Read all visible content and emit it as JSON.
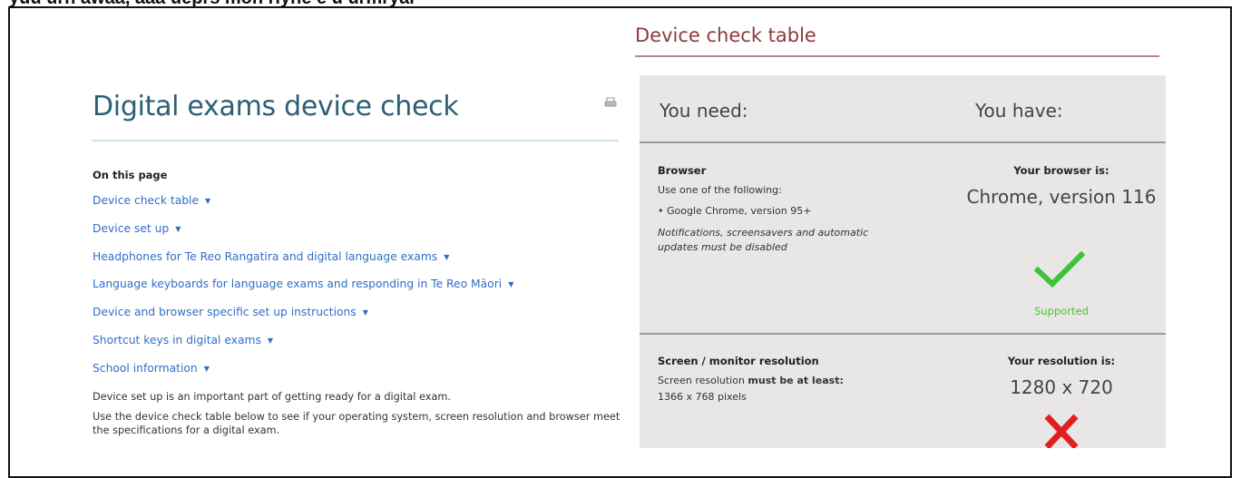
{
  "page": {
    "top_text": "yuu urn awaa, aaa ueprs mon riyne e u urmryar",
    "title": "Digital exams device check",
    "on_this_page_label": "On this page",
    "toc": [
      "Device check table",
      "Device set up",
      "Headphones for Te Reo Rangatira and digital language exams",
      "Language keyboards for language exams and responding in Te Reo Māori",
      "Device and browser specific set up instructions",
      "Shortcut keys in digital exams",
      "School information"
    ],
    "caret": "▼",
    "intro": [
      "Device set up is an important part of getting ready for a digital exam.",
      "Use the device check table below to see if your operating system, screen resolution and browser meet the specifications for a digital exam."
    ]
  },
  "device_check": {
    "heading": "Device check table",
    "you_need": "You need:",
    "you_have": "You have:",
    "browser": {
      "title": "Browser",
      "line1": "Use one of the following:",
      "bullet": "•  Google Chrome, version 95+",
      "note": "Notifications, screensavers and automatic updates must be disabled",
      "have_label": "Your browser is:",
      "have_value": "Chrome, version 116",
      "status": "Supported",
      "status_color": "#4fbf3a"
    },
    "resolution": {
      "title": "Screen / monitor resolution",
      "line1_prefix": "Screen resolution ",
      "line1_bold": "must be at least:",
      "line2": "1366 x 768 pixels",
      "have_label": "Your resolution is:",
      "have_value": "1280 x 720",
      "status_color": "#e02020"
    }
  },
  "icons": {
    "print": "printer-icon",
    "supported": "check-icon",
    "unsupported": "cross-icon"
  }
}
